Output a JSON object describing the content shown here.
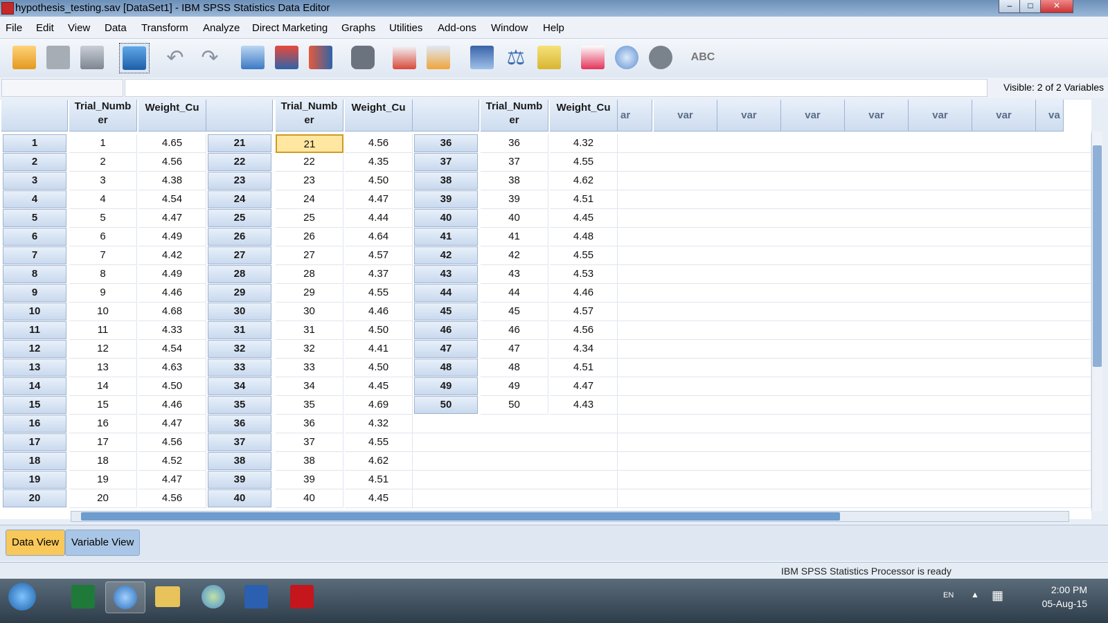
{
  "window": {
    "title": "hypothesis_testing.sav [DataSet1] - IBM SPSS Statistics Data Editor"
  },
  "menu": [
    "File",
    "Edit",
    "View",
    "Data",
    "Transform",
    "Analyze",
    "Direct Marketing",
    "Graphs",
    "Utilities",
    "Add-ons",
    "Window",
    "Help"
  ],
  "toolbar_icons": [
    "open-icon",
    "save-icon",
    "print-icon",
    "dialog-recall-icon",
    "undo-icon",
    "redo-icon",
    "goto-case-icon",
    "goto-variable-icon",
    "variables-icon",
    "find-icon",
    "insert-cases-icon",
    "insert-variable-icon",
    "split-file-icon",
    "weight-cases-icon",
    "select-cases-icon",
    "value-labels-icon",
    "use-sets-icon",
    "show-all-variables-icon",
    "spell-check-icon"
  ],
  "cellbar": {
    "visible_label": "Visible: 2 of 2 Variables"
  },
  "grid": {
    "headers": {
      "trial": [
        "Trial_Numb",
        "er"
      ],
      "weight": "Weight_Cu",
      "var": "var",
      "var_partial": "ar",
      "var_edge": "va"
    },
    "pane1_rows": [
      {
        "row": "1",
        "trial": "1",
        "weight": "4.65"
      },
      {
        "row": "2",
        "trial": "2",
        "weight": "4.56"
      },
      {
        "row": "3",
        "trial": "3",
        "weight": "4.38"
      },
      {
        "row": "4",
        "trial": "4",
        "weight": "4.54"
      },
      {
        "row": "5",
        "trial": "5",
        "weight": "4.47"
      },
      {
        "row": "6",
        "trial": "6",
        "weight": "4.49"
      },
      {
        "row": "7",
        "trial": "7",
        "weight": "4.42"
      },
      {
        "row": "8",
        "trial": "8",
        "weight": "4.49"
      },
      {
        "row": "9",
        "trial": "9",
        "weight": "4.46"
      },
      {
        "row": "10",
        "trial": "10",
        "weight": "4.68"
      },
      {
        "row": "11",
        "trial": "11",
        "weight": "4.33"
      },
      {
        "row": "12",
        "trial": "12",
        "weight": "4.54"
      },
      {
        "row": "13",
        "trial": "13",
        "weight": "4.63"
      },
      {
        "row": "14",
        "trial": "14",
        "weight": "4.50"
      },
      {
        "row": "15",
        "trial": "15",
        "weight": "4.46"
      },
      {
        "row": "16",
        "trial": "16",
        "weight": "4.47"
      },
      {
        "row": "17",
        "trial": "17",
        "weight": "4.56"
      },
      {
        "row": "18",
        "trial": "18",
        "weight": "4.52"
      },
      {
        "row": "19",
        "trial": "19",
        "weight": "4.47"
      },
      {
        "row": "20",
        "trial": "20",
        "weight": "4.56"
      }
    ],
    "pane2_rows": [
      {
        "row": "21",
        "trial": "21",
        "weight": "4.56"
      },
      {
        "row": "22",
        "trial": "22",
        "weight": "4.35"
      },
      {
        "row": "23",
        "trial": "23",
        "weight": "4.50"
      },
      {
        "row": "24",
        "trial": "24",
        "weight": "4.47"
      },
      {
        "row": "25",
        "trial": "25",
        "weight": "4.44"
      },
      {
        "row": "26",
        "trial": "26",
        "weight": "4.64"
      },
      {
        "row": "27",
        "trial": "27",
        "weight": "4.57"
      },
      {
        "row": "28",
        "trial": "28",
        "weight": "4.37"
      },
      {
        "row": "29",
        "trial": "29",
        "weight": "4.55"
      },
      {
        "row": "30",
        "trial": "30",
        "weight": "4.46"
      },
      {
        "row": "31",
        "trial": "31",
        "weight": "4.50"
      },
      {
        "row": "32",
        "trial": "32",
        "weight": "4.41"
      },
      {
        "row": "33",
        "trial": "33",
        "weight": "4.50"
      },
      {
        "row": "34",
        "trial": "34",
        "weight": "4.45"
      },
      {
        "row": "35",
        "trial": "35",
        "weight": "4.69"
      },
      {
        "row": "36",
        "trial": "36",
        "weight": "4.32"
      },
      {
        "row": "37",
        "trial": "37",
        "weight": "4.55"
      },
      {
        "row": "38",
        "trial": "38",
        "weight": "4.62"
      },
      {
        "row": "39",
        "trial": "39",
        "weight": "4.51"
      },
      {
        "row": "40",
        "trial": "40",
        "weight": "4.45"
      }
    ],
    "pane3_rows": [
      {
        "row": "36",
        "trial": "36",
        "weight": "4.32"
      },
      {
        "row": "37",
        "trial": "37",
        "weight": "4.55"
      },
      {
        "row": "38",
        "trial": "38",
        "weight": "4.62"
      },
      {
        "row": "39",
        "trial": "39",
        "weight": "4.51"
      },
      {
        "row": "40",
        "trial": "40",
        "weight": "4.45"
      },
      {
        "row": "41",
        "trial": "41",
        "weight": "4.48"
      },
      {
        "row": "42",
        "trial": "42",
        "weight": "4.55"
      },
      {
        "row": "43",
        "trial": "43",
        "weight": "4.53"
      },
      {
        "row": "44",
        "trial": "44",
        "weight": "4.46"
      },
      {
        "row": "45",
        "trial": "45",
        "weight": "4.57"
      },
      {
        "row": "46",
        "trial": "46",
        "weight": "4.56"
      },
      {
        "row": "47",
        "trial": "47",
        "weight": "4.34"
      },
      {
        "row": "48",
        "trial": "48",
        "weight": "4.51"
      },
      {
        "row": "49",
        "trial": "49",
        "weight": "4.47"
      },
      {
        "row": "50",
        "trial": "50",
        "weight": "4.43"
      }
    ]
  },
  "tabs": {
    "data_view": "Data View",
    "variable_view": "Variable View"
  },
  "status": {
    "processor": "IBM SPSS Statistics Processor is ready"
  },
  "taskbar": {
    "apps": [
      "windows-start-icon",
      "excel-icon",
      "spss-icon",
      "explorer-icon",
      "people-icon",
      "word-icon",
      "acrobat-icon"
    ],
    "language": "EN",
    "time": "2:00 PM",
    "date": "05-Aug-15"
  }
}
